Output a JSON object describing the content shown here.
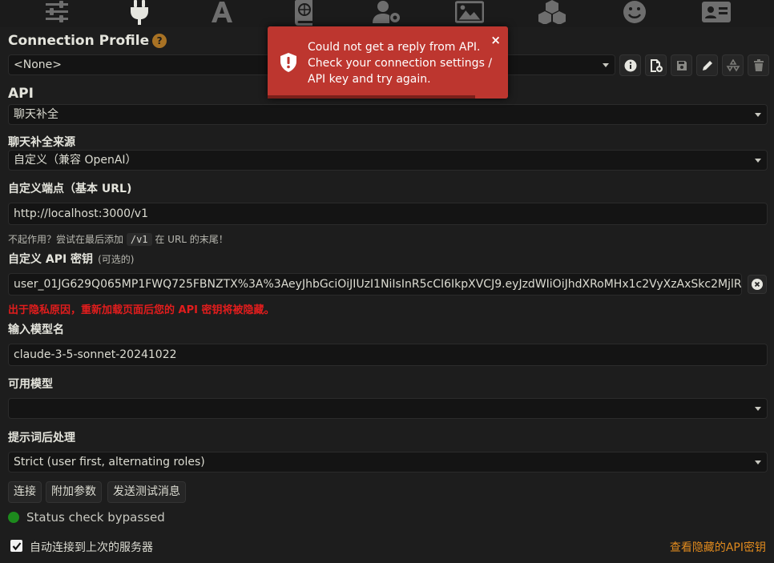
{
  "topbar": {
    "icons": [
      "sliders-icon",
      "plug-icon",
      "font-icon",
      "book-globe-icon",
      "user-gear-icon",
      "image-icon",
      "cubes-icon",
      "smiley-icon",
      "id-card-icon"
    ]
  },
  "connection_profile": {
    "title": "Connection Profile",
    "help": "?",
    "selected": "<None>"
  },
  "api": {
    "title": "API",
    "selected": "聊天补全"
  },
  "source": {
    "label": "聊天补全来源",
    "selected": "自定义（兼容 OpenAI）"
  },
  "endpoint": {
    "label": "自定义端点（基本 URL)",
    "value": "http://localhost:3000/v1",
    "hint_before": "不起作用？尝试在最后添加",
    "hint_code": "/v1",
    "hint_after": "在 URL 的末尾！"
  },
  "api_key": {
    "label": "自定义 API 密钥",
    "optional": "(可选的)",
    "value": "user_01JG629Q065MP1FWQ725FBNZTX%3A%3AeyJhbGciOiJIUzI1NiIsInR5cCI6IkpXVCJ9.eyJzdWIiOiJhdXRoMHx1c2VyXzAxSkc2MjlR",
    "warning": "出于隐私原因，重新加载页面后您的 API 密钥将被隐藏。"
  },
  "model_input": {
    "label": "输入模型名",
    "value": "claude-3-5-sonnet-20241022"
  },
  "available_models": {
    "label": "可用模型",
    "selected": ""
  },
  "postprocess": {
    "label": "提示词后处理",
    "selected": "Strict (user first, alternating roles)"
  },
  "buttons": {
    "connect": "连接",
    "extra_params": "附加参数",
    "send_test": "发送测试消息"
  },
  "status": {
    "text": "Status check bypassed",
    "color": "#1d8a1d"
  },
  "auto_connect": {
    "label": "自动连接到上次的服务器",
    "checked": true
  },
  "view_hidden_key": "查看隐藏的API密钥",
  "toast": {
    "message": "Could not get a reply from API. Check your connection settings / API key and try again.",
    "close": "×",
    "color": "#bd362f"
  }
}
